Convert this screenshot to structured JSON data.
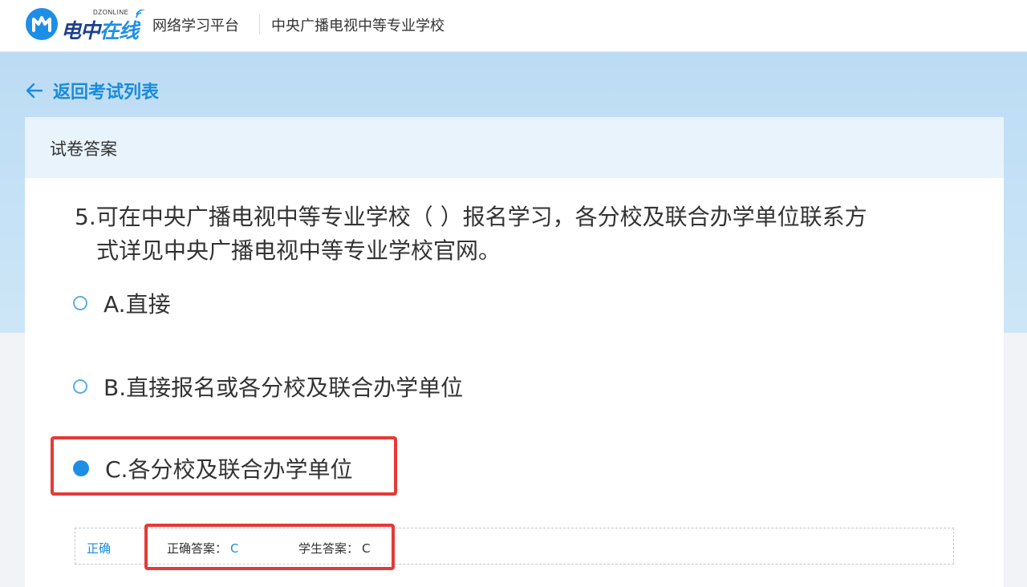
{
  "header": {
    "logo_small": "DZONLINE",
    "logo_text_a": "电中",
    "logo_text_b": "在线",
    "platform": "网络学习平台",
    "school": "中央广播电视中等专业学校"
  },
  "nav": {
    "back_label": "返回考试列表"
  },
  "card": {
    "title": "试卷答案"
  },
  "question": {
    "line1": "5.可在中央广播电视中等专业学校（ ）报名学习，各分校及联合办学单位联系方",
    "line2": "式详见中央广播电视中等专业学校官网。"
  },
  "options": [
    {
      "label": "A.直接",
      "selected": false
    },
    {
      "label": "B.直接报名或各分校及联合办学单位",
      "selected": false
    },
    {
      "label": "C.各分校及联合办学单位",
      "selected": true
    }
  ],
  "result": {
    "status": "正确",
    "correct_label": "正确答案：",
    "correct_value": "C",
    "student_label": "学生答案：",
    "student_value": "C"
  },
  "colors": {
    "accent": "#1d8ee6",
    "link": "#1a8bdc",
    "highlight": "#e53a37",
    "banner": "#c6e2f6"
  }
}
